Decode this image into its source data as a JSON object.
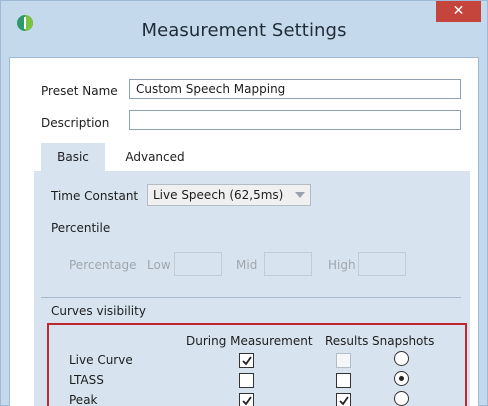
{
  "window": {
    "title": "Measurement Settings",
    "close_glyph": "✕"
  },
  "form": {
    "preset_label": "Preset Name",
    "preset_value": "Custom Speech Mapping",
    "description_label": "Description",
    "description_value": ""
  },
  "tabs": [
    {
      "label": "Basic",
      "active": true
    },
    {
      "label": "Advanced",
      "active": false
    }
  ],
  "basic": {
    "time_constant_label": "Time Constant",
    "time_constant_value": "Live Speech (62,5ms)",
    "percentile_label": "Percentile",
    "percentage_label": "Percentage",
    "low_label": "Low",
    "mid_label": "Mid",
    "high_label": "High"
  },
  "curves": {
    "section_label": "Curves visibility",
    "col_during": "During Measurement",
    "col_results": "Results",
    "col_snapshots": "Snapshots",
    "rows": [
      {
        "label": "Live Curve",
        "during": true,
        "results": false,
        "results_enabled": false,
        "snapshot": false
      },
      {
        "label": "LTASS",
        "during": false,
        "results": false,
        "results_enabled": true,
        "snapshot": true
      },
      {
        "label": "Peak",
        "during": true,
        "results": true,
        "results_enabled": true,
        "snapshot": false
      }
    ]
  },
  "colors": {
    "accent_border": "#c0282d",
    "close_button": "#c5443b",
    "panel": "#d7e4ef",
    "frame": "#c5d9ec"
  },
  "icons": {
    "app": "app-logo-icon",
    "close": "close-icon",
    "dropdown": "chevron-down-icon"
  }
}
